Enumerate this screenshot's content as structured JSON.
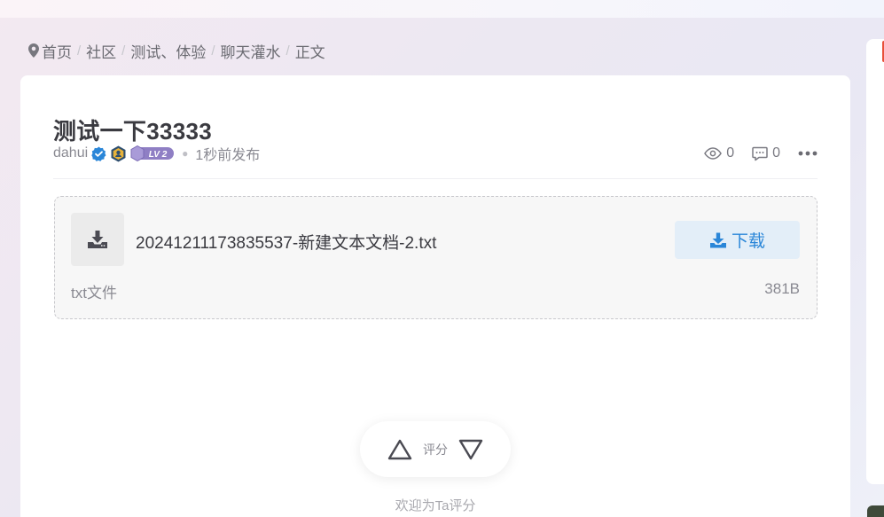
{
  "breadcrumb": {
    "items": [
      "首页",
      "社区",
      "测试、体验",
      "聊天灌水",
      "正文"
    ],
    "separator": "/"
  },
  "post": {
    "title": "测试一下33333",
    "author": "dahui",
    "level_badge": "LV 2",
    "published": "1秒前发布",
    "views": "0",
    "comments": "0"
  },
  "attachment": {
    "file_name": "20241211173835537-新建文本文档-2.txt",
    "download_label": "下载",
    "file_type": "txt文件",
    "file_size": "381B"
  },
  "rating": {
    "label": "评分",
    "hint": "欢迎为Ta评分"
  },
  "colors": {
    "accent": "#2a86d8",
    "download_bg": "#e3eef8",
    "verified": "#2a86d8",
    "level_badge": "#8f7fc4"
  },
  "icons": {
    "breadcrumb": "location-pin-icon",
    "views": "eye-icon",
    "comments": "comment-icon",
    "more": "more-dots-icon",
    "file": "download-tray-icon",
    "download": "download-arrow-icon",
    "upvote": "triangle-up-icon",
    "downvote": "triangle-down-icon"
  }
}
